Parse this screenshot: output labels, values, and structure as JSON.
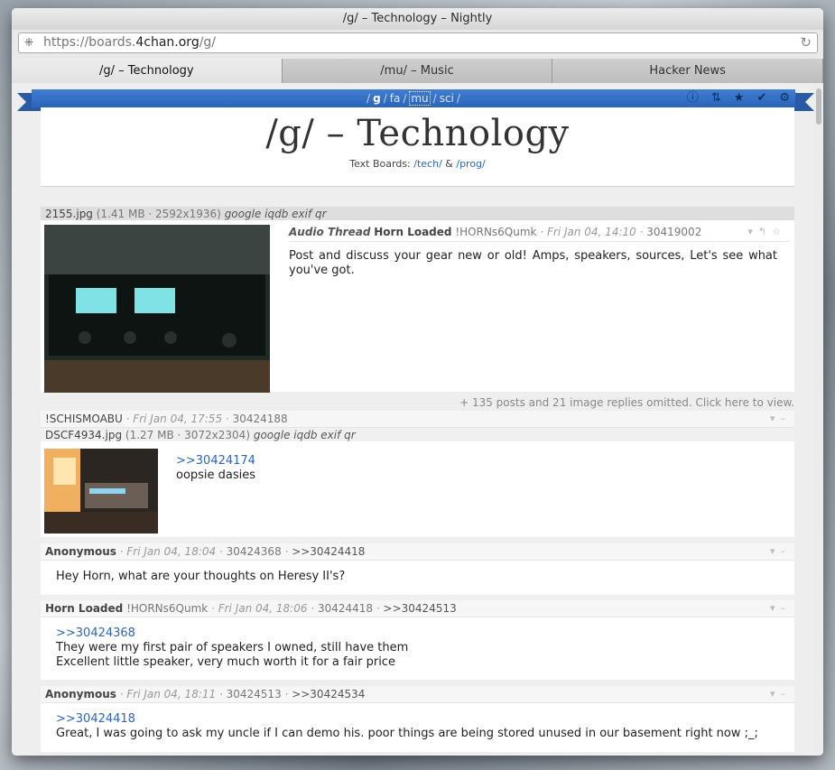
{
  "window": {
    "title": "/g/ – Technology – Nightly"
  },
  "urlbar": {
    "prefix": "https://boards.",
    "domain": "4chan.org",
    "path": "/g/"
  },
  "tabs": [
    {
      "label": "/g/ – Technology",
      "active": true
    },
    {
      "label": "/mu/ – Music",
      "active": false
    },
    {
      "label": "Hacker News",
      "active": false
    }
  ],
  "nav": {
    "boards": [
      "g",
      "fa",
      "mu",
      "sci"
    ],
    "current": "g",
    "icons": [
      "info-icon",
      "sort-icon",
      "star-icon",
      "check-icon",
      "gear-icon"
    ]
  },
  "board": {
    "title": "/g/ – Technology",
    "textboards_label": "Text Boards:",
    "tech": "/tech/",
    "amp": "&",
    "prog": "/prog/"
  },
  "op": {
    "file": {
      "name": "2155.jpg",
      "meta": "(1.41 MB · 2592x1936)",
      "links": "google iqdb exif qr"
    },
    "subject": "Audio Thread",
    "name": "Horn Loaded",
    "trip": "!HORNs6Qumk",
    "date": "Fri Jan 04, 14:10",
    "id": "30419002",
    "comment": "Post and discuss your gear new or old! Amps, speakers, sources, Let's see what you've got."
  },
  "omitted": "+ 135 posts and 21 image replies omitted. Click here to view.",
  "replies": [
    {
      "name": "!SCHISMOABU",
      "date": "Fri Jan 04, 17:55",
      "id": "30424188",
      "ref": "",
      "file": {
        "name": "DSCF4934.jpg",
        "meta": "(1.27 MB · 3072x2304)",
        "links": "google iqdb exif qr"
      },
      "quote": ">>30424174",
      "text": "oopsie dasies"
    },
    {
      "name": "Anonymous",
      "date": "Fri Jan 04, 18:04",
      "id": "30424368",
      "ref": ">>30424418",
      "text": "Hey Horn, what are your thoughts on Heresy II's?"
    },
    {
      "name": "Horn Loaded",
      "trip": "!HORNs6Qumk",
      "date": "Fri Jan 04, 18:06",
      "id": "30424418",
      "ref": ">>30424513",
      "quote": ">>30424368",
      "line1": "They were my first pair of speakers I owned, still have them",
      "line2": "Excellent little speaker, very much worth it for a fair price"
    },
    {
      "name": "Anonymous",
      "date": "Fri Jan 04, 18:11",
      "id": "30424513",
      "ref": ">>30424534",
      "quote": ">>30424418",
      "text": "Great, I was going to ask my uncle if I can demo his. poor things are being stored unused in our basement right now ;_;"
    }
  ],
  "colors": {
    "ribbon": "#3f7ed3",
    "link": "#2a66c2"
  }
}
